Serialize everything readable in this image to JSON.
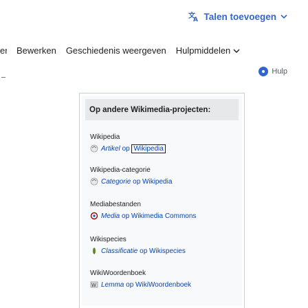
{
  "language": {
    "label": "Talen toevoegen"
  },
  "tabs": {
    "cut": "en",
    "edit": "Bewerken",
    "history": "Geschiedenis weergeven",
    "tools": "Hulpmiddelen"
  },
  "help": {
    "label": "Hulp"
  },
  "panel": {
    "heading": "Op andere Wikimedia-projecten:",
    "entries": [
      {
        "name": "Wikipedia",
        "link_italic": "Artikel",
        "link_rest": " op ",
        "link_boxed": "Wikipedia"
      },
      {
        "name": "Wikipedia-categorie",
        "link_italic": "Categorie",
        "link_rest": " op Wikipedia"
      },
      {
        "name": "Mediabestanden",
        "link_italic": "Media",
        "link_rest": " op Wikimedia Commons"
      },
      {
        "name": "Wikispecies",
        "link_italic": "Classificatie",
        "link_rest": " op Wikispecies"
      },
      {
        "name": "WikiWoordenboek",
        "link_italic": "Lemma",
        "link_rest": " op WikiWoordenboek"
      }
    ]
  },
  "colors": {
    "link": "#3366cc",
    "panel_border": "#a7d7f9",
    "panel_bg": "#f8f9fa",
    "header_bg": "#e6e8ea"
  }
}
